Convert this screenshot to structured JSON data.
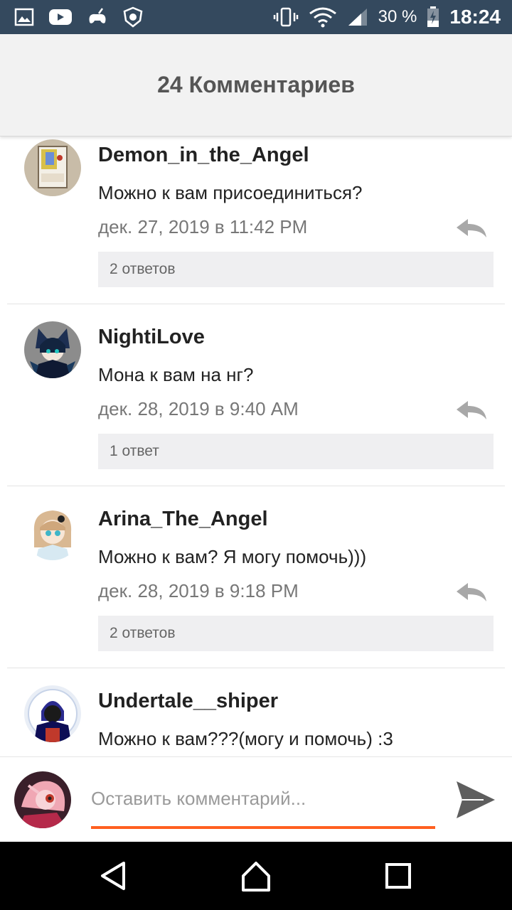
{
  "status_bar": {
    "battery_percent": "30 %",
    "time": "18:24",
    "left_icons": [
      "gallery-icon",
      "youtube-icon",
      "gamepad-icon",
      "shield-app-icon"
    ],
    "right_icons": [
      "vibrate-icon",
      "wifi-icon",
      "signal-icon",
      "battery-charging-icon"
    ]
  },
  "header": {
    "title": "24 Комментариев"
  },
  "comments": [
    {
      "username": "Demon_in_the_Angel",
      "text": "Можно к вам присоединиться?",
      "date": "дек. 27, 2019 в 11:42 PM",
      "replies": "2 ответов"
    },
    {
      "username": "NightiLove",
      "text": "Мона к вам на нг?",
      "date": "дек. 28, 2019 в 9:40 AM",
      "replies": "1 ответ"
    },
    {
      "username": "Arina_The_Angel",
      "text": "Можно к вам? Я могу помочь)))",
      "date": "дек. 28, 2019 в 9:18 PM",
      "replies": "2 ответов"
    },
    {
      "username": "Undertale__shiper",
      "text": "Можно к вам???(могу и помочь) :3",
      "date": "",
      "replies": ""
    }
  ],
  "composer": {
    "placeholder": "Оставить комментарий...",
    "accent_color": "#ff5f1f"
  },
  "colors": {
    "status_bar": "#34495e",
    "header_bg": "#f2f2f2",
    "reply_box_bg": "#efeff1"
  },
  "nav": {
    "icons": [
      "back-icon",
      "home-icon",
      "recents-icon"
    ]
  }
}
